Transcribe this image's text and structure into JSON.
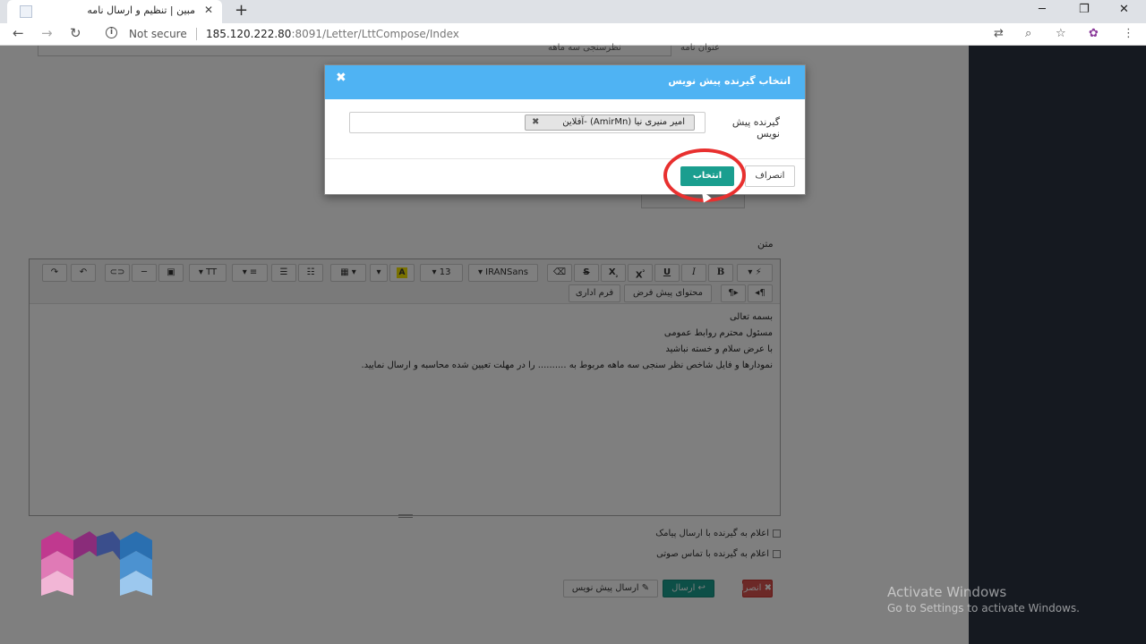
{
  "browser": {
    "tab_title": "مبین | تنظیم و ارسال نامه",
    "tab_close": "✕",
    "new_tab": "+",
    "not_secure": "Not secure",
    "url_host": "185.120.222.80",
    "url_path": ":8091/Letter/LttCompose/Index"
  },
  "page": {
    "partial_field_text": "نظرسنجی سه ماهه",
    "partial_field_label": "عنوان نامه",
    "matn_label": "متن",
    "editor": {
      "toolbar": {
        "font_name": "IRANSans",
        "font_size": "13",
        "bold": "B",
        "italic": "I",
        "underline": "U",
        "superscript": "X",
        "subscript": "X",
        "strike": "S",
        "highlight": "A",
        "text_size": "T",
        "default_content": "محتوای پیش فرض",
        "admin_form": "فرم اداری"
      },
      "lines": [
        "بسمه تعالی",
        "مسئول محترم روابط عمومی",
        "با عرض سلام و خسته نباشید",
        "نمودارها و فایل شاخص نظر سنجی سه ماهه مربوط به .......... را در مهلت تعیین شده محاسبه و ارسال نمایید."
      ]
    },
    "checkboxes": [
      "اعلام به گیرنده با ارسال پیامک",
      "اعلام به گیرنده با تماس صوتی"
    ],
    "buttons": {
      "cancel": "✖ انصراف",
      "send": "↩ ارسال",
      "draft": "✎ ارسال پیش نویس"
    }
  },
  "modal": {
    "title": "انتخاب گیرنده پیش نویس",
    "close": "✖",
    "recipient_label": "گیرنده پیش نویس",
    "selected_recipient": "امیر منیری نیا (AmirMn) -آفلاین",
    "tag_remove": "✖",
    "cancel_label": "انصراف",
    "select_label": "انتخاب"
  },
  "watermark": {
    "line1": "Activate Windows",
    "line2": "Go to Settings to activate Windows."
  }
}
